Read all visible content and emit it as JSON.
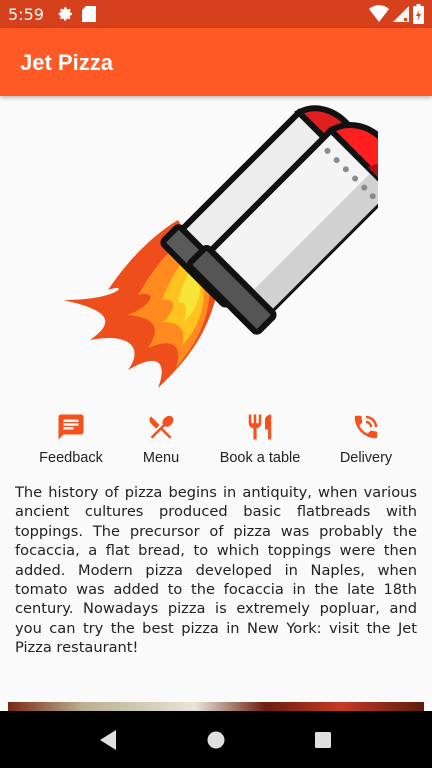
{
  "status_bar": {
    "time": "5:59",
    "icons": [
      "gear-icon",
      "sd-card-icon",
      "wifi-icon",
      "signal-icon",
      "battery-icon"
    ]
  },
  "app_bar": {
    "title": "Jet Pizza"
  },
  "hero": {
    "image": "rocket-icon"
  },
  "actions": [
    {
      "label": "Feedback",
      "icon": "feedback-icon"
    },
    {
      "label": "Menu",
      "icon": "menu-utensils-icon"
    },
    {
      "label": "Book a table",
      "icon": "restaurant-icon"
    },
    {
      "label": "Delivery",
      "icon": "phone-call-icon"
    }
  ],
  "history_text": "The history of pizza begins in antiquity, when various ancient cultures produced basic flatbreads with toppings. The precursor of pizza was probably the focaccia, a flat bread, to which toppings were then added. Modern pizza developed in Naples, when tomato was added to the focaccia in the late 18th century. Nowadays pizza is extremely popluar, and you can try the best pizza in New York: visit the Jet Pizza restaurant!",
  "colors": {
    "primary": "#ff5a26",
    "primary_dark": "#d6411d",
    "accent_icon": "#f4511e",
    "background": "#fafafa"
  },
  "nav_bar": {
    "buttons": [
      "back-icon",
      "home-icon",
      "recents-icon"
    ]
  }
}
